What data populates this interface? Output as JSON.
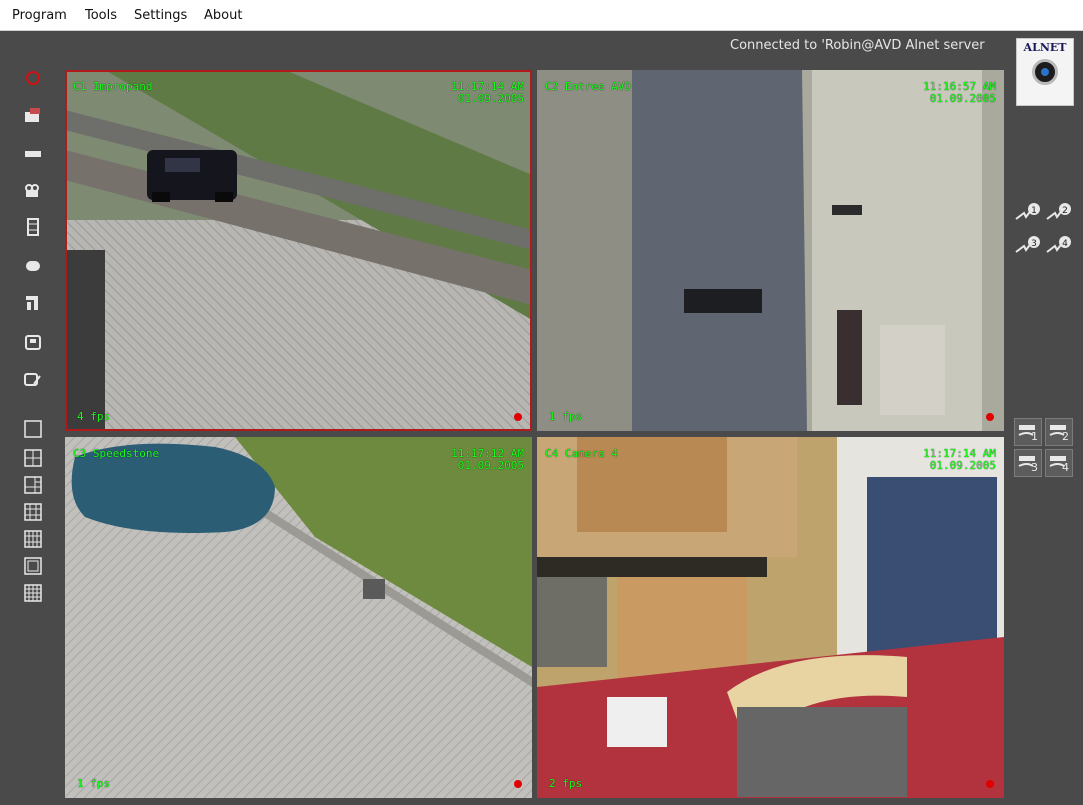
{
  "menu": [
    "Program",
    "Tools",
    "Settings",
    "About"
  ],
  "status": "Connected to 'Robin@AVD  Alnet server",
  "logo": {
    "text": "ALNET"
  },
  "cameras": [
    {
      "name": "C1 Impropand",
      "time": "11:17:14 AM",
      "date": "01.09.2005",
      "fps": "4 fps",
      "selected": true
    },
    {
      "name": "C2 Entree AVD",
      "time": "11:16:57 AM",
      "date": "01.09.2005",
      "fps": "1 fps",
      "selected": false
    },
    {
      "name": "C3 Speedstone",
      "time": "11:17:12 AM",
      "date": "01.09.2005",
      "fps": "1 fps",
      "selected": false
    },
    {
      "name": "C4 Camera 4",
      "time": "11:17:14 AM",
      "date": "01.09.2005",
      "fps": "2 fps",
      "selected": false
    }
  ],
  "right_panel": {
    "group1": [
      "1",
      "2",
      "3",
      "4"
    ],
    "group2": [
      "1",
      "2",
      "3",
      "4"
    ]
  },
  "icons": {
    "sidebar_tools": [
      "record-icon",
      "camera-icon",
      "dvr-icon",
      "video-camera-icon",
      "film-icon",
      "disk-icon",
      "wrench-icon",
      "save-icon",
      "save-as-icon"
    ],
    "layouts": [
      "layout-1-icon",
      "layout-4-icon",
      "layout-6-icon",
      "layout-9-icon",
      "layout-12-icon",
      "layout-13-icon",
      "layout-16-icon"
    ]
  },
  "colors": {
    "overlay_text": "#19ff19",
    "selected_border": "#b01a1a",
    "record_dot": "#e00000"
  }
}
